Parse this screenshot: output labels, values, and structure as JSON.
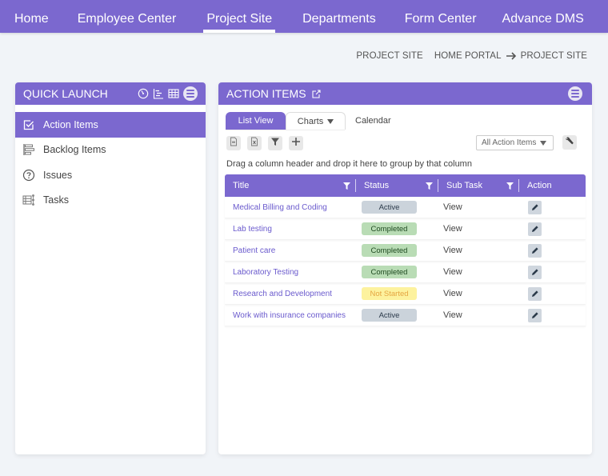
{
  "nav": {
    "items": [
      {
        "label": "Home",
        "active": false
      },
      {
        "label": "Employee Center",
        "active": false
      },
      {
        "label": "Project Site",
        "active": true
      },
      {
        "label": "Departments",
        "active": false
      },
      {
        "label": "Form Center",
        "active": false
      },
      {
        "label": "Advance DMS",
        "active": false
      }
    ]
  },
  "breadcrumb": {
    "page": "PROJECT SITE",
    "root": "HOME PORTAL",
    "current": "PROJECT SITE"
  },
  "quick_launch": {
    "title": "QUICK LAUNCH",
    "header_icons": [
      "dashboard-icon",
      "gantt-icon",
      "table-icon",
      "menu-icon"
    ],
    "items": [
      {
        "label": "Action Items",
        "icon": "checkbox-icon",
        "active": true
      },
      {
        "label": "Backlog Items",
        "icon": "backlog-icon",
        "active": false
      },
      {
        "label": "Issues",
        "icon": "question-icon",
        "active": false
      },
      {
        "label": "Tasks",
        "icon": "tasks-icon",
        "active": false
      }
    ]
  },
  "action_items": {
    "title": "ACTION ITEMS",
    "tabs": {
      "list_view": "List View",
      "charts": "Charts",
      "calendar": "Calendar"
    },
    "toolbar_icons": [
      "export-pdf-icon",
      "export-excel-icon",
      "filter-icon",
      "add-icon"
    ],
    "view_select": "All Action Items",
    "group_hint": "Drag a column header and drop it here to group by that column",
    "columns": {
      "title": "Title",
      "status": "Status",
      "sub_task": "Sub Task",
      "action": "Action"
    },
    "rows": [
      {
        "title": "Medical Billing and Coding",
        "status": "Active",
        "status_type": "active",
        "sub_task": "View"
      },
      {
        "title": "Lab testing",
        "status": "Completed",
        "status_type": "completed",
        "sub_task": "View"
      },
      {
        "title": "Patient care",
        "status": "Completed",
        "status_type": "completed",
        "sub_task": "View"
      },
      {
        "title": "Laboratory Testing",
        "status": "Completed",
        "status_type": "completed",
        "sub_task": "View"
      },
      {
        "title": "Research and Development",
        "status": "Not Started",
        "status_type": "notstarted",
        "sub_task": "View"
      },
      {
        "title": "Work with insurance companies",
        "status": "Active",
        "status_type": "active",
        "sub_task": "View"
      }
    ]
  },
  "colors": {
    "accent": "#7b68cf",
    "background": "#f1f4f8",
    "active_badge": "#cbd3db",
    "completed_badge": "#b9dcb5",
    "not_started_badge": "#fdf29e"
  }
}
